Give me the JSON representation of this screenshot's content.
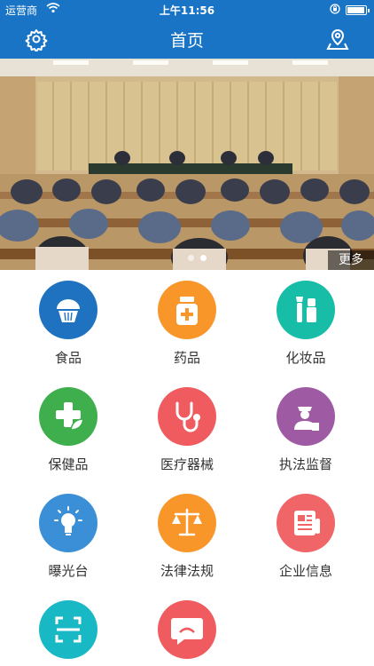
{
  "status_bar": {
    "carrier": "运营商",
    "time": "上午11:56"
  },
  "nav": {
    "title": "首页",
    "left_icon": "gear-icon",
    "right_icon": "location-pin-icon"
  },
  "banner": {
    "more_label": "更多"
  },
  "grid": {
    "items": [
      {
        "label": "食品",
        "icon": "muffin-icon",
        "color": "#1f72c0"
      },
      {
        "label": "药品",
        "icon": "medicine-bottle-icon",
        "color": "#f8962a"
      },
      {
        "label": "化妆品",
        "icon": "cosmetics-icon",
        "color": "#17bda6"
      },
      {
        "label": "保健品",
        "icon": "health-leaf-icon",
        "color": "#3fae4c"
      },
      {
        "label": "医疗器械",
        "icon": "stethoscope-icon",
        "color": "#ef5b5e"
      },
      {
        "label": "执法监督",
        "icon": "officer-icon",
        "color": "#9e5aa3"
      },
      {
        "label": "曝光台",
        "icon": "light-bulb-icon",
        "color": "#3b8fd6"
      },
      {
        "label": "法律法规",
        "icon": "scales-icon",
        "color": "#f8962a"
      },
      {
        "label": "企业信息",
        "icon": "news-icon",
        "color": "#f06568"
      },
      {
        "label": "",
        "icon": "scan-icon",
        "color": "#19b8c5"
      },
      {
        "label": "",
        "icon": "chat-icon",
        "color": "#ef5b5e"
      }
    ]
  }
}
